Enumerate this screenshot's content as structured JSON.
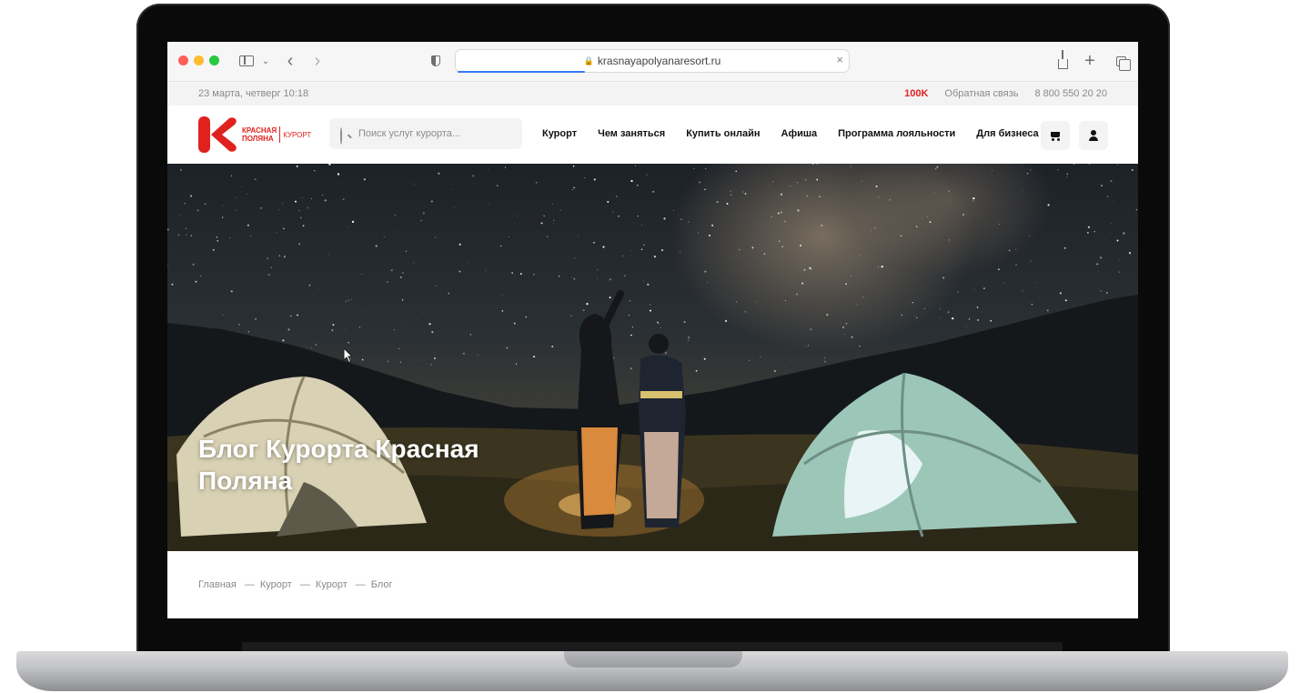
{
  "browser": {
    "url": "krasnayapolyanaresort.ru"
  },
  "info_strip": {
    "date": "23 марта, четверг 10:18",
    "lang": "100K",
    "feedback": "Обратная связь",
    "phone": "8 800 550 20 20"
  },
  "logo": {
    "name_line1": "КРАСНАЯ",
    "name_line2": "ПОЛЯНА",
    "sub": "КУРОРТ",
    "color": "#e0221f"
  },
  "search": {
    "placeholder": "Поиск услуг курорта..."
  },
  "nav": {
    "items": [
      {
        "label": "Курорт"
      },
      {
        "label": "Чем заняться"
      },
      {
        "label": "Купить онлайн"
      },
      {
        "label": "Афиша"
      },
      {
        "label": "Программа лояльности"
      },
      {
        "label": "Для бизнеса"
      }
    ]
  },
  "header_icons": [
    "cart-icon",
    "user-icon"
  ],
  "hero": {
    "title": "Блог Курорта Красная Поляна"
  },
  "breadcrumb": {
    "items": [
      "Главная",
      "Курорт",
      "Курорт",
      "Блог"
    ],
    "separator": "—"
  }
}
